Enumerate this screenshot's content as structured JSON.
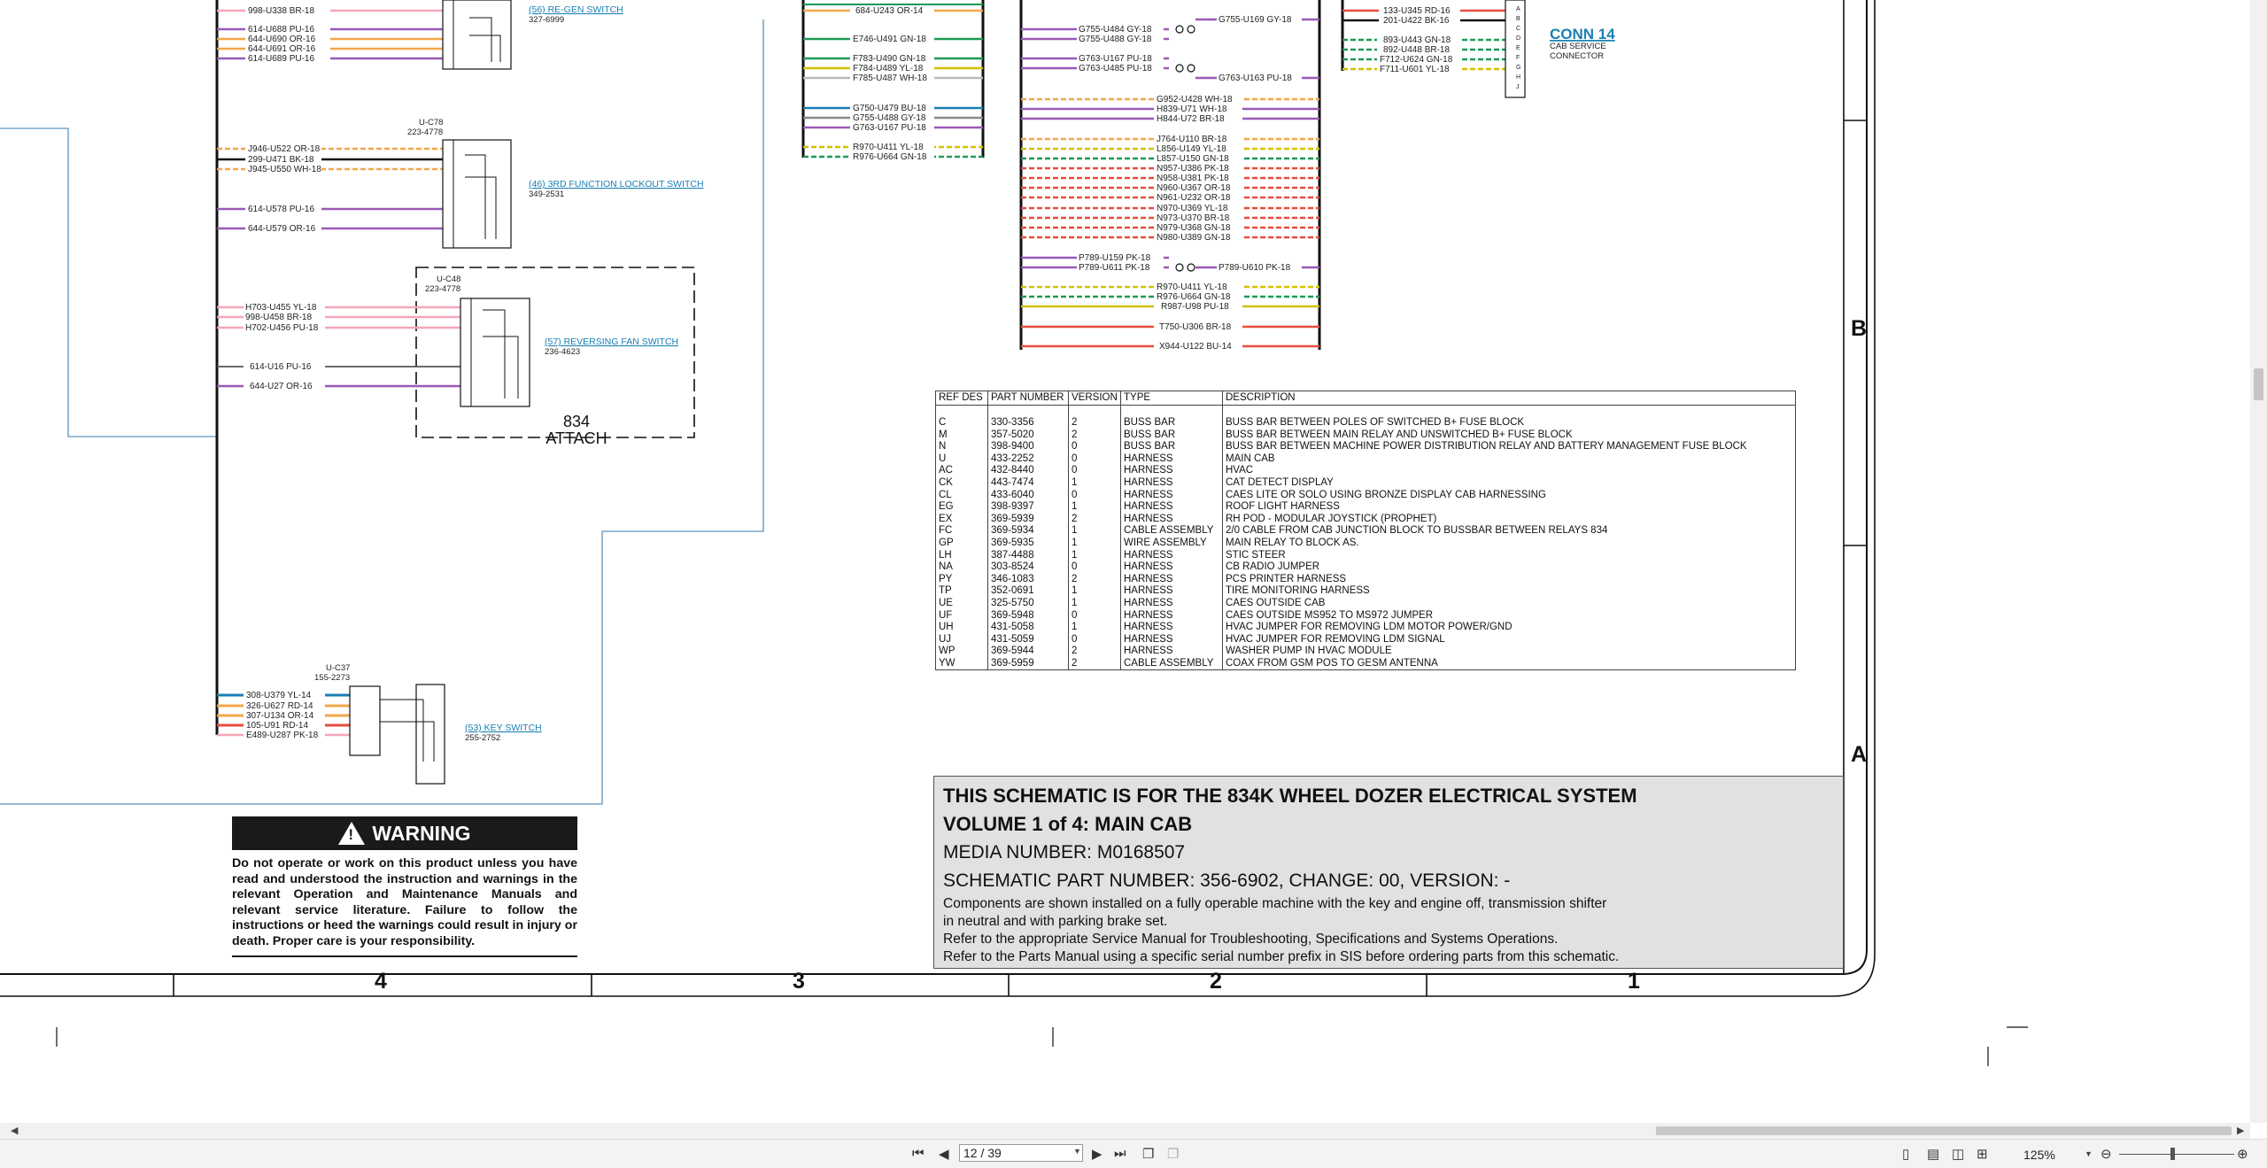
{
  "wires_upper_left": [
    "998-U338 BR-18",
    "614-U688 PU-16",
    "644-U690 OR-16",
    "644-U691 OR-16",
    "614-U689 PU-16"
  ],
  "switch_56": {
    "link": "(56) RE-GEN SWITCH",
    "part": "327-6999"
  },
  "connector_c78": {
    "name": "U-C78",
    "part": "223-4778"
  },
  "wires_c78": [
    "J946-U522 OR-18",
    "299-U471 BK-18",
    "J945-U550 WH-18",
    "614-U578 PU-16",
    "644-U579 OR-16"
  ],
  "switch_46": {
    "link": "(46) 3RD FUNCTION LOCKOUT SWITCH",
    "part": "349-2531"
  },
  "connector_c48": {
    "name": "U-C48",
    "part": "223-4778"
  },
  "wires_c48": [
    "H703-U455 YL-18",
    "998-U458 BR-18",
    "H702-U456 PU-18",
    "614-U16 PU-16",
    "644-U27 OR-16"
  ],
  "switch_57": {
    "link": "(57) REVERSING FAN SWITCH",
    "part": "236-4623"
  },
  "attach_label": {
    "line1": "834",
    "line2": "ATTACH"
  },
  "connector_c37": {
    "name": "U-C37",
    "part": "155-2273"
  },
  "wires_c37": [
    "308-U379 YL-14",
    "326-U627 RD-14",
    "307-U134 OR-14",
    "105-U91 RD-14",
    "E489-U287 PK-18"
  ],
  "switch_53": {
    "link": "(53) KEY SWITCH",
    "part": "255-2752"
  },
  "wires_mid_left": [
    "684-U243 OR-14",
    "E746-U491 GN-18",
    "F783-U490 GN-18",
    "F784-U489 YL-18",
    "F785-U487 WH-18",
    "G750-U479 BU-18",
    "G755-U488 GY-18",
    "G763-U167 PU-18",
    "R970-U411 YL-18",
    "R976-U664 GN-18"
  ],
  "wires_center_left": [
    "G755-U484 GY-18",
    "G755-U488 GY-18",
    "G763-U167 PU-18",
    "G763-U485 PU-18",
    "P789-U159 PK-18",
    "P789-U611 PK-18"
  ],
  "wires_center_right": [
    "G755-U169 GY-18",
    "G763-U163 PU-18",
    "P789-U610 PK-18"
  ],
  "wires_center": [
    "G952-U428 WH-18",
    "H839-U71 WH-18",
    "H844-U72 BR-18",
    "J764-U110 BR-18",
    "L856-U149 YL-18",
    "L857-U150 GN-18",
    "N957-U386 PK-18",
    "N958-U381 PK-18",
    "N960-U367 OR-18",
    "N961-U232 OR-18",
    "N970-U369 YL-18",
    "N973-U370 BR-18",
    "N979-U368 GN-18",
    "N980-U389 GN-18",
    "R970-U411 YL-18",
    "R976-U664 GN-18",
    "R987-U98 PU-18",
    "T750-U306 BR-18",
    "X944-U122 BU-14"
  ],
  "wires_conn14": [
    "133-U345 RD-16",
    "201-U422 BK-16",
    "893-U443 GN-18",
    "892-U448 BR-18",
    "F712-U624 GN-18",
    "F711-U601 YL-18"
  ],
  "conn14": {
    "title": "CONN 14",
    "line1": "CAB SERVICE",
    "line2": "CONNECTOR",
    "pins": [
      "A",
      "B",
      "C",
      "D",
      "E",
      "F",
      "G",
      "H",
      "J"
    ]
  },
  "parts_table": {
    "headers": [
      "REF DES",
      "PART NUMBER",
      "VERSION",
      "TYPE",
      "DESCRIPTION"
    ],
    "rows": [
      [
        "C",
        "330-3356",
        "2",
        "BUSS BAR",
        "BUSS BAR BETWEEN POLES OF SWITCHED B+ FUSE BLOCK"
      ],
      [
        "M",
        "357-5020",
        "2",
        "BUSS BAR",
        "BUSS BAR BETWEEN MAIN RELAY AND UNSWITCHED B+ FUSE BLOCK"
      ],
      [
        "N",
        "398-9400",
        "0",
        "BUSS BAR",
        "BUSS BAR BETWEEN MACHINE POWER DISTRIBUTION RELAY AND BATTERY MANAGEMENT FUSE BLOCK"
      ],
      [
        "U",
        "433-2252",
        "0",
        "HARNESS",
        "MAIN CAB"
      ],
      [
        "AC",
        "432-8440",
        "0",
        "HARNESS",
        "HVAC"
      ],
      [
        "CK",
        "443-7474",
        "1",
        "HARNESS",
        "CAT DETECT DISPLAY"
      ],
      [
        "CL",
        "433-6040",
        "0",
        "HARNESS",
        "CAES LITE OR SOLO USING BRONZE DISPLAY CAB HARNESSING"
      ],
      [
        "EG",
        "398-9397",
        "1",
        "HARNESS",
        "ROOF LIGHT HARNESS"
      ],
      [
        "EX",
        "369-5939",
        "2",
        "HARNESS",
        "RH POD - MODULAR JOYSTICK (PROPHET)"
      ],
      [
        "FC",
        "369-5934",
        "1",
        "CABLE ASSEMBLY",
        "2/0 CABLE FROM CAB JUNCTION BLOCK TO BUSSBAR BETWEEN RELAYS 834"
      ],
      [
        "GP",
        "369-5935",
        "1",
        "WIRE ASSEMBLY",
        "MAIN RELAY TO BLOCK AS."
      ],
      [
        "LH",
        "387-4488",
        "1",
        "HARNESS",
        "STIC STEER"
      ],
      [
        "NA",
        "303-8524",
        "0",
        "HARNESS",
        "CB RADIO JUMPER"
      ],
      [
        "PY",
        "346-1083",
        "2",
        "HARNESS",
        "PCS PRINTER HARNESS"
      ],
      [
        "TP",
        "352-0691",
        "1",
        "HARNESS",
        "TIRE MONITORING HARNESS"
      ],
      [
        "UE",
        "325-5750",
        "1",
        "HARNESS",
        "CAES OUTSIDE CAB"
      ],
      [
        "UF",
        "369-5948",
        "0",
        "HARNESS",
        "CAES OUTSIDE MS952 TO MS972 JUMPER"
      ],
      [
        "UH",
        "431-5058",
        "1",
        "HARNESS",
        "HVAC JUMPER FOR REMOVING LDM MOTOR POWER/GND"
      ],
      [
        "UJ",
        "431-5059",
        "0",
        "HARNESS",
        "HVAC JUMPER FOR REMOVING LDM SIGNAL"
      ],
      [
        "WP",
        "369-5944",
        "2",
        "HARNESS",
        "WASHER PUMP IN HVAC MODULE"
      ],
      [
        "YW",
        "369-5959",
        "2",
        "CABLE ASSEMBLY",
        "COAX FROM GSM POS TO GESM ANTENNA"
      ]
    ]
  },
  "title_block": {
    "line1": "THIS SCHEMATIC IS FOR THE 834K WHEEL DOZER ELECTRICAL SYSTEM",
    "line2": "VOLUME 1 of 4: MAIN CAB",
    "line3": "MEDIA NUMBER: M0168507",
    "line4": "SCHEMATIC PART NUMBER: 356-6902, CHANGE: 00, VERSION: -",
    "note1": "Components are shown installed on a fully operable machine with the key and engine off, transmission shifter",
    "note2": "in neutral and with parking brake set.",
    "note3": "Refer to the appropriate Service Manual for Troubleshooting, Specifications and Systems Operations.",
    "note4": "Refer to the Parts Manual using a specific serial number prefix in SIS before ordering parts from this schematic."
  },
  "warning": {
    "title": "WARNING",
    "text": "Do not operate or work on this product unless you have read and understood the instruction and warnings in the relevant Operation and Maintenance Manuals and relevant service literature. Failure to follow the instructions or heed the warnings could result in injury or death. Proper care is your responsibility."
  },
  "zones": {
    "b": "B",
    "a": "A",
    "col4": "4",
    "col3": "3",
    "col2": "2",
    "col1": "1"
  },
  "toolbar": {
    "page": "12 / 39",
    "zoom": "125%"
  },
  "colors": {
    "purple": "#9b59b6",
    "pink": "#f4a6b8",
    "orange": "#f2a64a",
    "red": "#e74c3c",
    "green": "#1d9a55",
    "yellow": "#d4c000",
    "blue_trace": "#7aa6c8",
    "link": "#1a7fb3"
  }
}
